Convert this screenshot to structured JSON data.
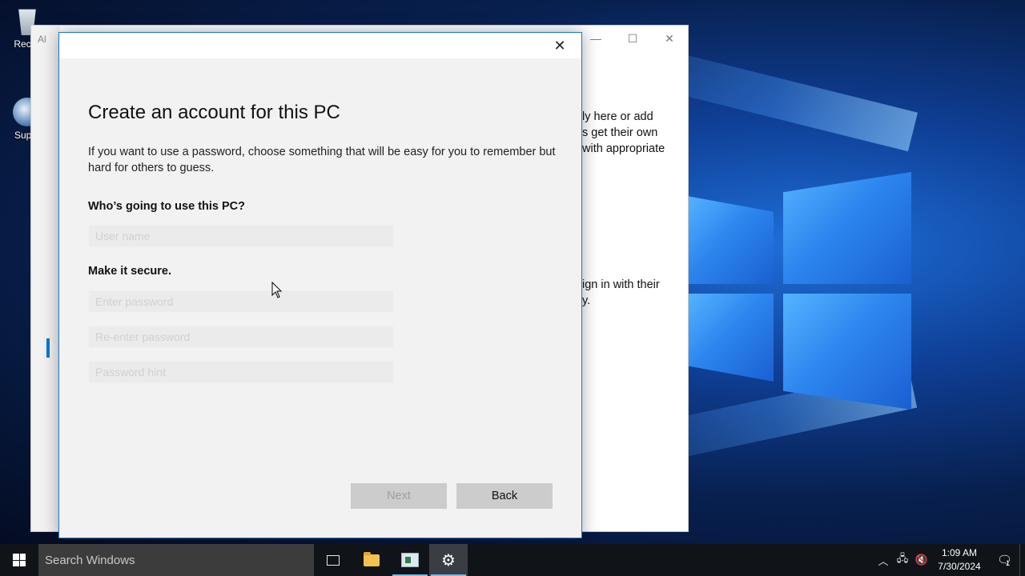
{
  "desktop": {
    "icons": [
      {
        "label": "Recyc"
      },
      {
        "label": "Super"
      }
    ]
  },
  "background_window": {
    "partial_label": "Al",
    "text_lines_1": [
      "ly here or add",
      "s get their own",
      "with appropriate"
    ],
    "text_lines_2": [
      "ign in with their",
      "y."
    ]
  },
  "dialog": {
    "title": "Create an account for this PC",
    "description": "If you want to use a password, choose something that will be easy for you to remember but hard for others to guess.",
    "who_label": "Who’s going to use this PC?",
    "username_placeholder": "User name",
    "secure_label": "Make it secure.",
    "password_placeholder": "Enter password",
    "reenter_placeholder": "Re-enter password",
    "hint_placeholder": "Password hint",
    "next_label": "Next",
    "back_label": "Back"
  },
  "taskbar": {
    "search_placeholder": "Search Windows",
    "time": "1:09 AM",
    "date": "7/30/2024",
    "notification_count": "1"
  },
  "colors": {
    "accent": "#0078d7",
    "taskbar": "#101418",
    "dialog_bg": "#f2f2f2"
  }
}
